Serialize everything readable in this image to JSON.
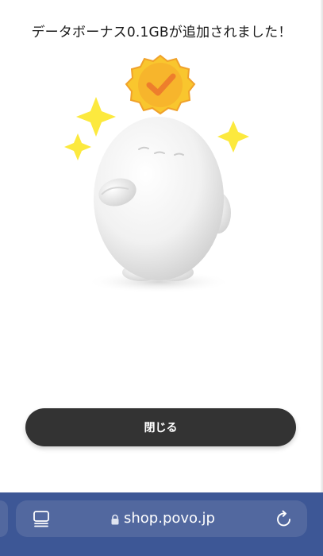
{
  "message": {
    "text": "データボーナス0.1GBが追加されました！"
  },
  "illustration": {
    "description_name": "egg-mascot",
    "badge_color": "#F6B42A",
    "sparkle_color": "#FCE93E"
  },
  "actions": {
    "close_label": "閉じる"
  },
  "browser": {
    "url": "shop.povo.jp",
    "bar_color": "#3D5796"
  },
  "icons": {
    "tabs": "tabs-icon",
    "lock": "lock-icon",
    "reload": "reload-icon",
    "check": "check-badge-icon",
    "sparkle": "sparkle-icon"
  }
}
